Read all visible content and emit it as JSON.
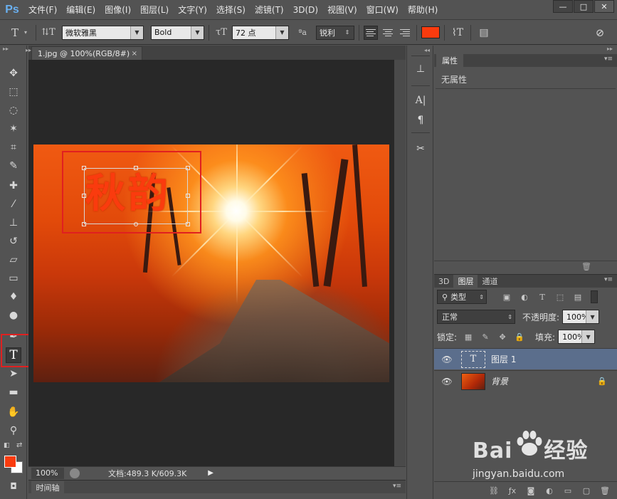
{
  "app": {
    "logo": "Ps"
  },
  "menu": [
    "文件(F)",
    "编辑(E)",
    "图像(I)",
    "图层(L)",
    "文字(Y)",
    "选择(S)",
    "滤镜(T)",
    "3D(D)",
    "视图(V)",
    "窗口(W)",
    "帮助(H)"
  ],
  "window_controls": {
    "minimize": "—",
    "maximize": "□",
    "close": "✕"
  },
  "options": {
    "font_family": "微软雅黑",
    "font_style": "Bold",
    "font_size": "72 点",
    "aa_label": "ªa",
    "anti_alias": "锐利",
    "text_color": "#fa3b0e"
  },
  "document": {
    "tab_title": "1.jpg @ 100%(RGB/8#)",
    "tab_close": "×",
    "canvas_text": "秋韵",
    "zoom": "100%",
    "doc_size": "文档:489.3 K/609.3K"
  },
  "timeline": {
    "tab": "时间轴"
  },
  "properties": {
    "tab": "属性",
    "label": "无属性"
  },
  "layers": {
    "tabs": [
      "3D",
      "图层",
      "通道"
    ],
    "filter": "类型",
    "blend_mode": "正常",
    "opacity_label": "不透明度:",
    "opacity": "100%",
    "lock_label": "锁定:",
    "fill_label": "填充:",
    "fill": "100%",
    "items": [
      {
        "name": "图层 1",
        "thumb": "T",
        "selected": true
      },
      {
        "name": "背景",
        "locked": true,
        "selected": false
      }
    ]
  },
  "colors": {
    "foreground": "#fa3b0e",
    "background": "#ffffff",
    "highlight": "#e02020",
    "selected_layer": "#5b6e8c"
  },
  "watermark": {
    "logo_left": "Bai",
    "logo_right": "经验",
    "url": "jingyan.baidu.com"
  }
}
